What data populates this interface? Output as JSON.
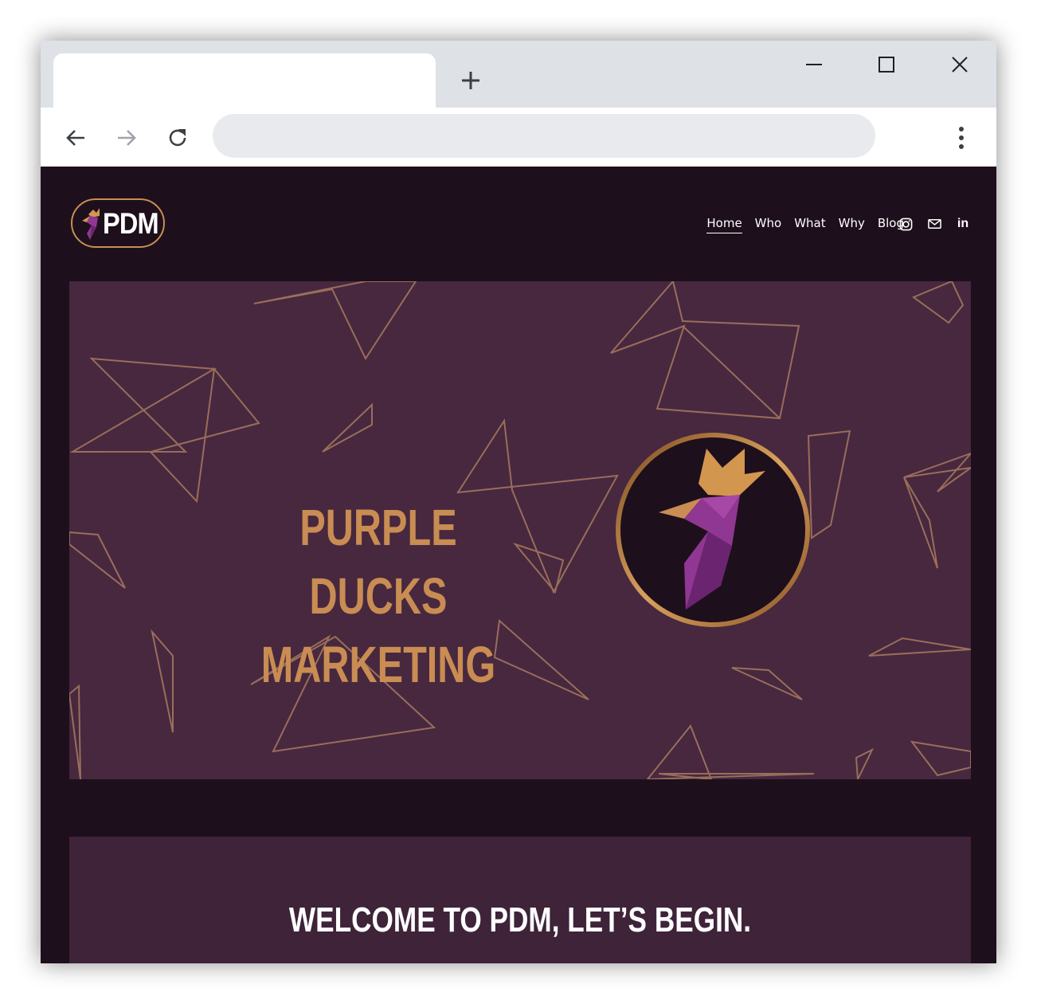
{
  "browser": {
    "tab_title": "",
    "address": "",
    "new_tab_icon": "plus-icon",
    "window_controls": [
      "minimize-icon",
      "maximize-icon",
      "close-icon"
    ],
    "nav_icons": [
      "back-arrow-icon",
      "forward-arrow-icon",
      "reload-icon",
      "kebab-menu-icon"
    ]
  },
  "site": {
    "logo_text": "PDM",
    "nav": [
      {
        "label": "Home",
        "active": true
      },
      {
        "label": "Who",
        "active": false
      },
      {
        "label": "What",
        "active": false
      },
      {
        "label": "Why",
        "active": false
      },
      {
        "label": "Blog",
        "active": false
      }
    ],
    "social_icons": [
      "instagram-icon",
      "mail-icon",
      "linkedin-icon"
    ],
    "linkedin_label": "in",
    "hero": {
      "title_line1": "PURPLE DUCKS",
      "title_line2": "MARKETING"
    },
    "welcome": {
      "heading": "WELCOME TO PDM, LET’S BEGIN."
    },
    "colors": {
      "page_bg": "#1e0f1c",
      "hero_bg": "#47283f",
      "section_bg": "#3e2339",
      "accent_gold": "#c98c52",
      "duck_purple": "#8e3a8e"
    }
  }
}
